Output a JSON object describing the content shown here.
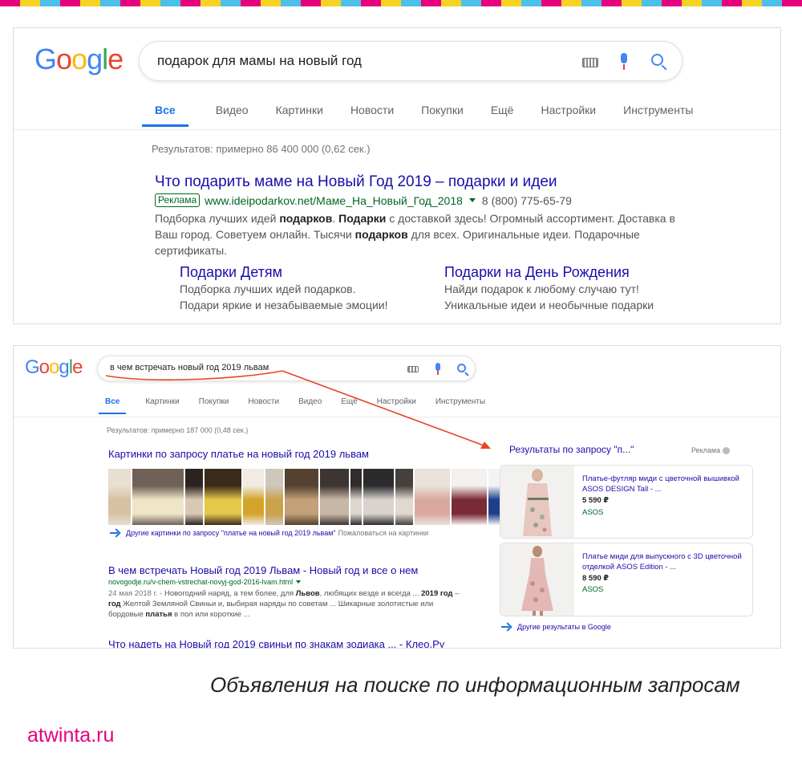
{
  "strip_colors": [
    "#e6007e",
    "#f6d322",
    "#4cc0e8",
    "#e6007e",
    "#f6d322",
    "#4cc0e8",
    "#e6007e",
    "#f6d322",
    "#4cc0e8",
    "#e6007e",
    "#f6d322",
    "#4cc0e8",
    "#e6007e",
    "#f6d322",
    "#4cc0e8",
    "#e6007e",
    "#f6d322",
    "#4cc0e8",
    "#e6007e",
    "#f6d322",
    "#4cc0e8",
    "#e6007e",
    "#f6d322",
    "#4cc0e8",
    "#e6007e",
    "#f6d322",
    "#4cc0e8",
    "#e6007e",
    "#f6d322",
    "#4cc0e8",
    "#e6007e",
    "#f6d322",
    "#4cc0e8",
    "#e6007e",
    "#f6d322",
    "#4cc0e8",
    "#e6007e",
    "#f6d322",
    "#4cc0e8",
    "#e6007e"
  ],
  "logo": {
    "g1": "G",
    "o1": "o",
    "o2": "o",
    "g2": "g",
    "l": "l",
    "e": "e"
  },
  "shot1": {
    "query": "подарок для мамы на новый год",
    "tabs": [
      "Все",
      "Видео",
      "Картинки",
      "Новости",
      "Покупки",
      "Ещё",
      "Настройки",
      "Инструменты"
    ],
    "stats": "Результатов: примерно 86 400 000 (0,62 сек.)",
    "ad": {
      "title": "Что подарить маме на Новый Год 2019 – подарки и идеи",
      "badge": "Реклама",
      "url": "www.ideipodarkov.net/Маме_На_Новый_Год_2018",
      "phone": "8 (800) 775-65-79",
      "desc": [
        {
          "t": "Подборка лучших идей ",
          "b": false
        },
        {
          "t": "подарков",
          "b": true
        },
        {
          "t": ". ",
          "b": false
        },
        {
          "t": "Подарки",
          "b": true
        },
        {
          "t": " с доставкой здесь! Огромный ассортимент. Доставка в Ваш город. Советуем онлайн. Тысячи ",
          "b": false
        },
        {
          "t": "подарков",
          "b": true
        },
        {
          "t": " для всех. Оригинальные идеи. Подарочные сертификаты.",
          "b": false
        }
      ]
    },
    "sitelinks": [
      {
        "title": "Подарки Детям",
        "line1": "Подборка лучших идей подарков.",
        "line2": "Подари яркие и незабываемые эмоции!"
      },
      {
        "title": "Подарки на День Рождения",
        "line1": "Найди подарок к любому случаю тут!",
        "line2": "Уникальные идеи и необычные подарки"
      }
    ]
  },
  "shot2": {
    "query": "в чем встречать новый год 2019 львам",
    "tabs": [
      "Все",
      "Картинки",
      "Покупки",
      "Новости",
      "Видео",
      "Ещё",
      "Настройки",
      "Инструменты"
    ],
    "stats": "Результатов: примерно 187 000 (0,48 сек.)",
    "images_title": "Картинки по запросу платье на новый год 2019 львам",
    "image_thumbs": [
      {
        "w": 28,
        "bg": "#e8ded2",
        "fg": "#d7c2a4"
      },
      {
        "w": 64,
        "bg": "#6f6158",
        "fg": "#efe6c8"
      },
      {
        "w": 22,
        "bg": "#2c2320",
        "fg": "#d9c9b4"
      },
      {
        "w": 46,
        "bg": "#3a2a1c",
        "fg": "#e3c84a"
      },
      {
        "w": 26,
        "bg": "#f1ebe2",
        "fg": "#d4a42a"
      },
      {
        "w": 22,
        "bg": "#cfc7bd",
        "fg": "#c9a24a"
      },
      {
        "w": 42,
        "bg": "#54412f",
        "fg": "#c2a078"
      },
      {
        "w": 36,
        "bg": "#3d3532",
        "fg": "#c8b7a6"
      },
      {
        "w": 14,
        "bg": "#312c2b",
        "fg": "#ddd6cf"
      },
      {
        "w": 38,
        "bg": "#2b2a2d",
        "fg": "#d8d3ce"
      },
      {
        "w": 22,
        "bg": "#45403d",
        "fg": "#e0d8d1"
      },
      {
        "w": 44,
        "bg": "#e8e2da",
        "fg": "#d9a9a0"
      },
      {
        "w": 44,
        "bg": "#f3f0ee",
        "fg": "#7a2a36"
      },
      {
        "w": 48,
        "bg": "#f3f3f5",
        "fg": "#1f3e8c"
      }
    ],
    "images_more": "Другие картинки по запросу \"платье на новый год 2019 львам\"",
    "images_report": "Пожаловаться на картинки",
    "result1": {
      "title": "В чем встречать Новый год 2019 Львам - Новый год и все о нем",
      "url": "novogodje.ru/v-chem-vstrechat-novyj-god-2016-lvam.html",
      "snippet": [
        {
          "t": "24 мая 2018 г. - ",
          "b": false,
          "g": true
        },
        {
          "t": "Новогодний наряд, а тем более, для ",
          "b": false
        },
        {
          "t": "Львов",
          "b": true
        },
        {
          "t": ", любящих везде и всегда ... ",
          "b": false
        },
        {
          "t": "2019 год",
          "b": true
        },
        {
          "t": " – ",
          "b": false
        },
        {
          "t": "год",
          "b": true
        },
        {
          "t": " Желтой Земляной Свиньи и, выбирая наряды по советам ... Шикарные золотистые или бордовые ",
          "b": false
        },
        {
          "t": "платья",
          "b": true
        },
        {
          "t": " в пол или короткие ...",
          "b": false
        }
      ]
    },
    "result2_title": "Что надеть на Новый год 2019 свиньи по знакам зодиака ... - Клео.Ру",
    "ads_heading": "Результаты по запросу \"п...\"",
    "ads_label": "Реклама",
    "products": [
      {
        "title": "Платье-футляр миди с цветочной вышивкой ASOS DESIGN Tall - ...",
        "price": "5 590 ₽",
        "store": "ASOS",
        "dress": "#e7c7bf",
        "accent": "#8fa78a"
      },
      {
        "title": "Платье миди для выпускного с 3D цветочной отделкой ASOS Edition - ...",
        "price": "8 590 ₽",
        "store": "ASOS",
        "dress": "#e2b9b5",
        "accent": "#d7a3a0"
      }
    ],
    "ads_more": "Другие результаты в Google"
  },
  "caption": "Объявления на поиске по информационным запросам",
  "brand": "atwinta.ru",
  "colors": {
    "arrow": "#e8442a",
    "link": "#1a0dab",
    "url": "#006621",
    "brand": "#e6007e"
  }
}
